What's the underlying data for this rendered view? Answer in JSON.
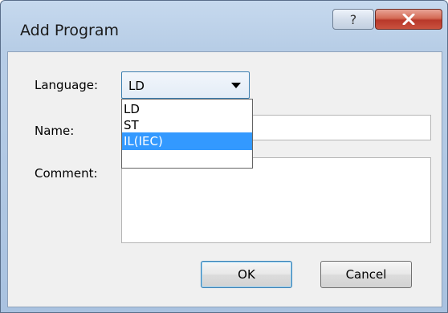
{
  "window": {
    "title": "Add Program",
    "help_glyph": "?",
    "close_glyph": "X"
  },
  "form": {
    "language_label": "Language:",
    "language_value": "LD",
    "name_label": "Name:",
    "name_value": "",
    "comment_label": "Comment:",
    "comment_value": ""
  },
  "dropdown": {
    "options": [
      "LD",
      "ST",
      "IL(IEC)"
    ],
    "highlighted": "IL(IEC)"
  },
  "buttons": {
    "ok": "OK",
    "cancel": "Cancel"
  },
  "colors": {
    "highlight": "#3399ff",
    "close_button": "#c9523e",
    "title_bar": "#b7cde6"
  },
  "icons": {
    "help": "question-mark-icon",
    "close": "close-x-icon",
    "dropdown": "chevron-down-icon"
  }
}
